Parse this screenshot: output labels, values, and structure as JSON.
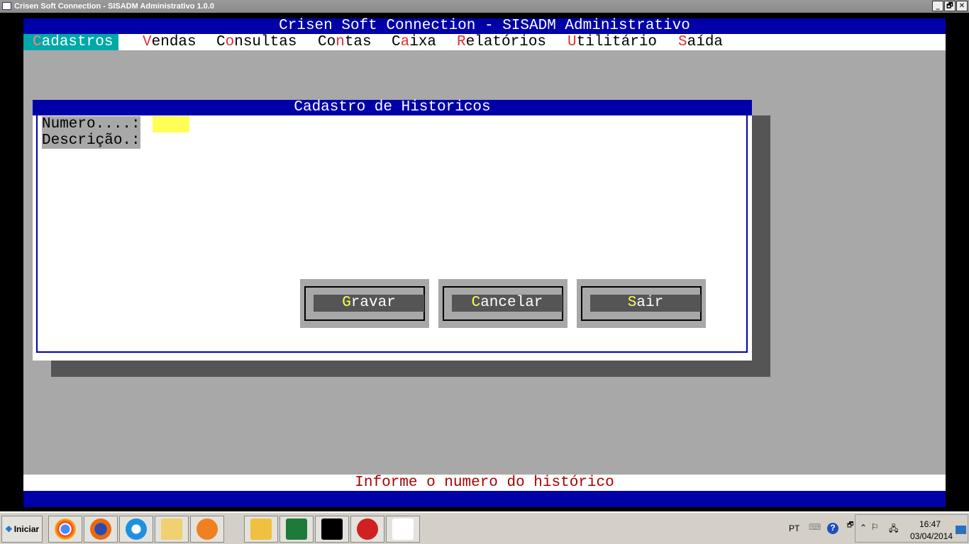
{
  "window": {
    "title": "Crisen Soft Connection - SISADM Administrativo  1.0.0",
    "buttons": [
      "_",
      "🗗",
      "✕"
    ]
  },
  "app": {
    "header": "Crisen Soft Connection - SISADM Administrativo",
    "menu": [
      {
        "pre": "",
        "key": "C",
        "post": "adastros"
      },
      {
        "pre": "",
        "key": "V",
        "post": "endas"
      },
      {
        "pre": "C",
        "key": "o",
        "post": "nsultas"
      },
      {
        "pre": "Co",
        "key": "n",
        "post": "tas"
      },
      {
        "pre": "C",
        "key": "a",
        "post": "ixa"
      },
      {
        "pre": "",
        "key": "R",
        "post": "elatórios"
      },
      {
        "pre": "",
        "key": "U",
        "post": "tilitário"
      },
      {
        "pre": "",
        "key": "S",
        "post": "aída"
      }
    ],
    "status": "Informe o numero do histórico"
  },
  "dialog": {
    "title": "Cadastro de Historicos",
    "numero_label": "Numero....:",
    "numero_value": "",
    "descricao_label": "Descrição.:",
    "buttons": [
      {
        "key": "G",
        "rest": "ravar"
      },
      {
        "key": "C",
        "rest": "ancelar"
      },
      {
        "key": "S",
        "rest": "air"
      }
    ]
  },
  "taskbar": {
    "start": "Iniciar",
    "apps": [
      "chrome",
      "firefox",
      "internet-explorer",
      "file-explorer",
      "media-player",
      "outlook",
      "excel",
      "command-prompt",
      "ccleaner",
      "document"
    ],
    "lang": "PT",
    "time": "16:47",
    "date": "03/04/2014"
  }
}
